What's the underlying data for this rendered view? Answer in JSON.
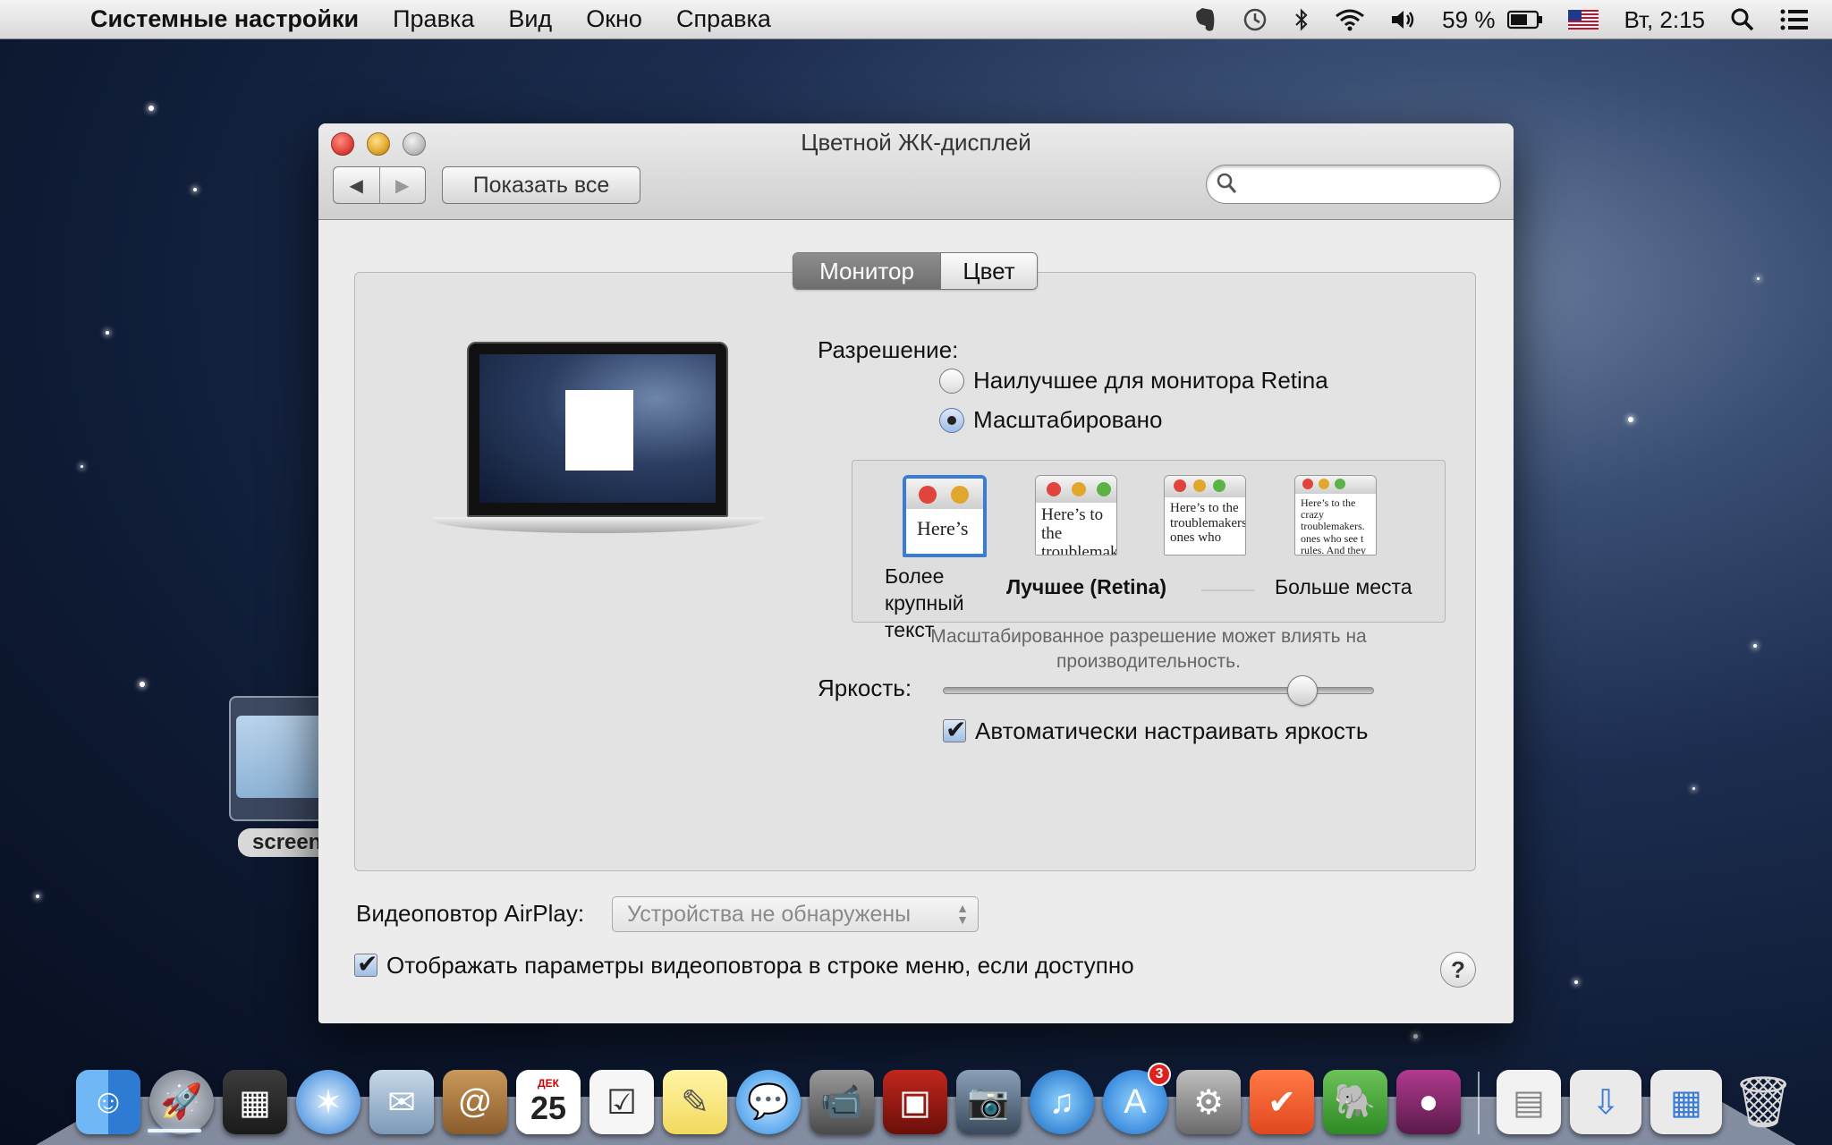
{
  "menubar": {
    "app_name": "Системные настройки",
    "items": [
      "Правка",
      "Вид",
      "Окно",
      "Справка"
    ],
    "battery": "59 %",
    "clock": "Вт, 2:15"
  },
  "desktop": {
    "folder_label": "screen"
  },
  "window": {
    "title": "Цветной ЖК-дисплей",
    "show_all": "Показать все",
    "search_placeholder": ""
  },
  "tabs": [
    {
      "label": "Монитор",
      "active": true
    },
    {
      "label": "Цвет",
      "active": false
    }
  ],
  "display": {
    "resolution_label": "Разрешение:",
    "option_best": "Наилучшее для монитора Retina",
    "option_scaled": "Масштабировано",
    "selected_option": "Масштабировано",
    "scaled_choices": [
      {
        "label": "Более крупный текст",
        "preview_text": "Here’s"
      },
      {
        "label": "",
        "preview_text": "Here’s to the troublemakers"
      },
      {
        "label": "Лучшее (Retina)",
        "preview_text": "Here’s to the troublemakers ones who"
      },
      {
        "label": "Больше места",
        "preview_text": "Here’s to the crazy troublemakers. ones who see t rules. And they"
      }
    ],
    "selected_choice": "Более крупный текст",
    "scaled_note": "Масштабированное разрешение может влиять на производительность.",
    "brightness_label": "Яркость:",
    "brightness_value": 0.86,
    "auto_brightness_label": "Автоматически настраивать яркость",
    "auto_brightness_checked": true
  },
  "airplay": {
    "label": "Видеоповтор AirPlay:",
    "value": "Устройства не обнаружены",
    "show_in_menu_label": "Отображать параметры видеоповтора в строке меню, если доступно",
    "show_in_menu_checked": true
  },
  "help_label": "?",
  "dock": {
    "calendar_day": "25",
    "calendar_month": "ДЕК",
    "appstore_badge": "3",
    "items": [
      "finder-icon",
      "launchpad-icon",
      "mission-control-icon",
      "safari-icon",
      "mail-icon",
      "contacts-icon",
      "calendar-icon",
      "reminders-icon",
      "notes-icon",
      "messages-icon",
      "facetime-icon",
      "photo-booth-icon",
      "iphoto-icon",
      "itunes-icon",
      "app-store-icon",
      "system-preferences-icon",
      "wunderlist-icon",
      "evernote-icon",
      "angry-birds-icon"
    ]
  }
}
